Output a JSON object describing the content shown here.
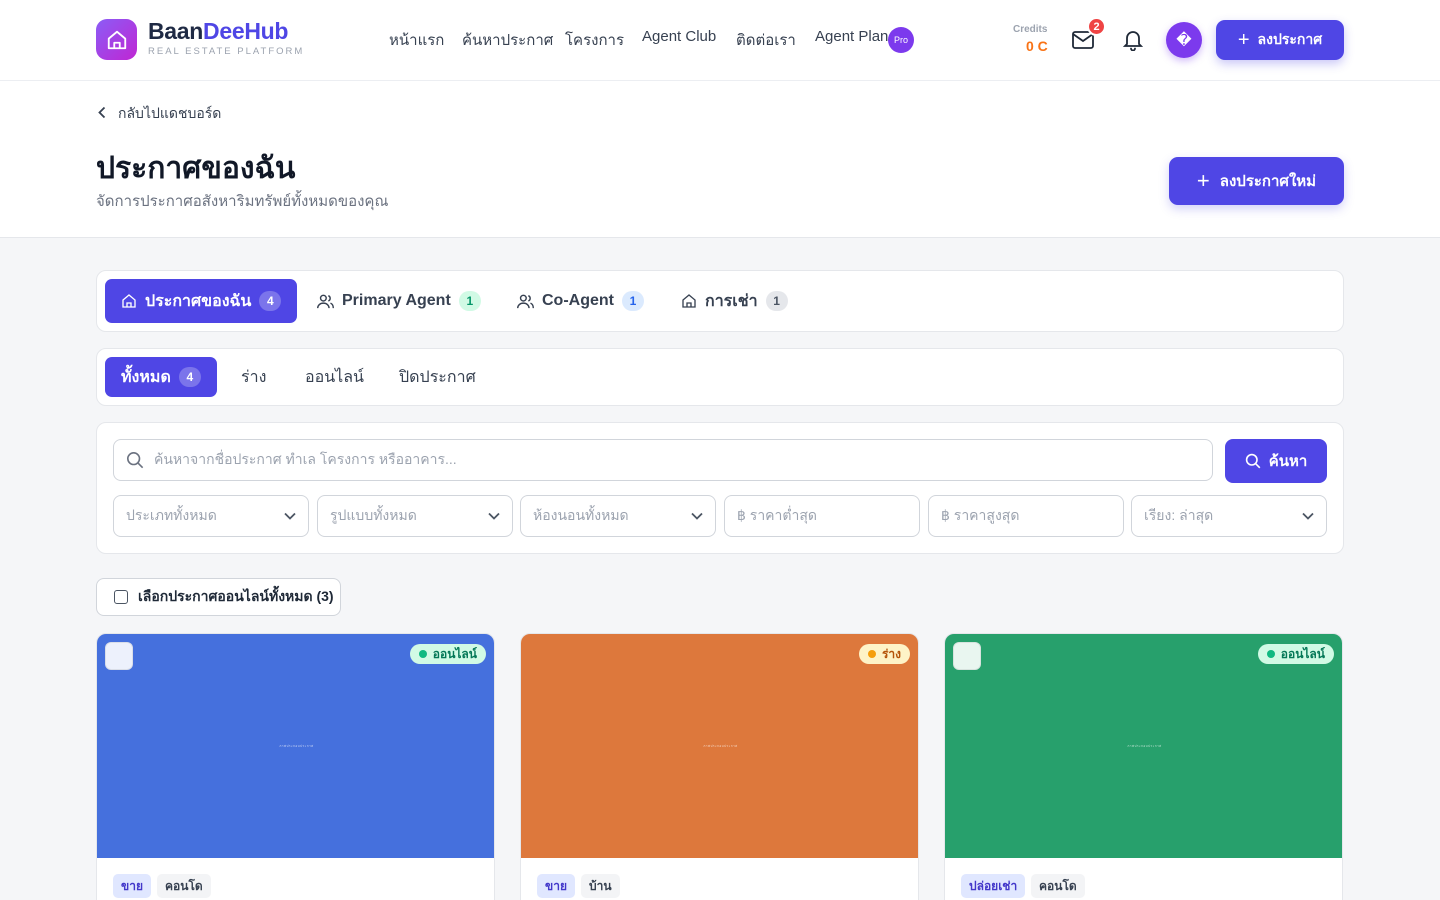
{
  "brand": {
    "name_part1": "Baan",
    "name_part2": "DeeHub",
    "tagline": "REAL ESTATE PLATFORM"
  },
  "nav": [
    {
      "label": "หน้าแรก"
    },
    {
      "label": "ค้นหาประกาศ"
    },
    {
      "label": "โครงการ"
    },
    {
      "label": "Agent Club"
    },
    {
      "label": "ติดต่อเรา"
    },
    {
      "label": "Agent Plan",
      "badge": "Pro"
    }
  ],
  "header": {
    "credits_label": "Credits",
    "credits_value": "0 C",
    "mail_count": "2",
    "avatar_glyph": "�",
    "post_button": "ลงประกาศ"
  },
  "page": {
    "back_label": "กลับไปแดชบอร์ด",
    "title": "ประกาศของฉัน",
    "subtitle": "จัดการประกาศอสังหาริมทรัพย์ทั้งหมดของคุณ",
    "new_button": "ลงประกาศใหม่"
  },
  "owner_tabs": [
    {
      "label": "ประกาศของฉัน",
      "count": "4"
    },
    {
      "label": "Primary Agent",
      "count": "1"
    },
    {
      "label": "Co-Agent",
      "count": "1"
    },
    {
      "label": "การเช่า",
      "count": "1"
    }
  ],
  "status_tabs": [
    {
      "label": "ทั้งหมด",
      "count": "4"
    },
    {
      "label": "ร่าง"
    },
    {
      "label": "ออนไลน์"
    },
    {
      "label": "ปิดประกาศ"
    }
  ],
  "search": {
    "placeholder": "ค้นหาจากชื่อประกาศ ทำเล โครงการ หรืออาคาร...",
    "button": "ค้นหา"
  },
  "filters": [
    {
      "label": "ประเภททั้งหมด"
    },
    {
      "label": "รูปแบบทั้งหมด"
    },
    {
      "label": "ห้องนอนทั้งหมด"
    },
    {
      "label": "฿  ราคาต่ำสุด"
    },
    {
      "label": "฿  ราคาสูงสุด"
    },
    {
      "label": "เรียง: ล่าสุด"
    }
  ],
  "select_all_label": "เลือกประกาศออนไลน์ทั้งหมด (3)",
  "listings": [
    {
      "status": "ออนไลน์",
      "deal": "ขาย",
      "type": "คอนโด",
      "color": "#4570dd",
      "caption": "ภาพประกอบประกาศ"
    },
    {
      "status": "ร่าง",
      "deal": "ขาย",
      "type": "บ้าน",
      "color": "#dd783c",
      "caption": "ภาพประกอบประกาศ"
    },
    {
      "status": "ออนไลน์",
      "deal": "ปล่อยเช่า",
      "type": "คอนโด",
      "color": "#27a06c",
      "caption": "ภาพประกอบประกาศ"
    }
  ],
  "colors": {
    "primary": "#4f46e5",
    "credits": "#f97316",
    "badge": "#ef4444"
  }
}
